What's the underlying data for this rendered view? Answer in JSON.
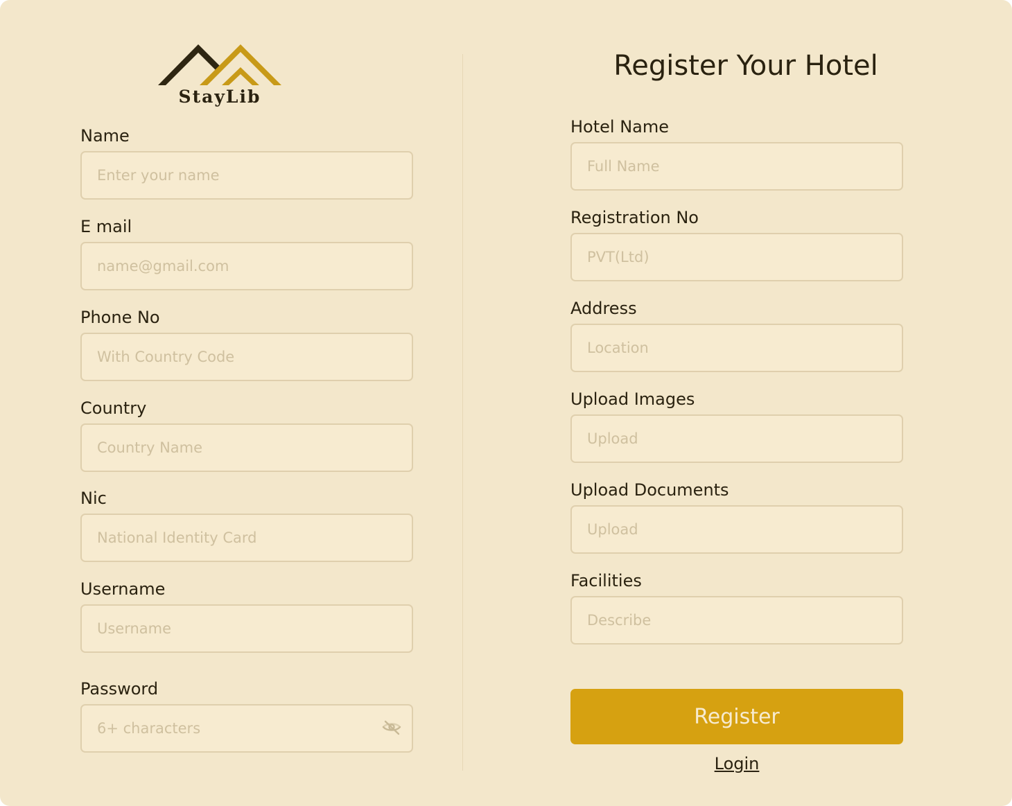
{
  "brand": {
    "name": "StayLib",
    "logo_icon": "mountain-roofs-logo"
  },
  "colors": {
    "background": "#f3e7cb",
    "input_background": "#f7ebd0",
    "input_border": "#dfcfad",
    "accent": "#d6a111",
    "text": "#2a2210",
    "placeholder": "#cfc09f"
  },
  "left_form": {
    "name": {
      "label": "Name",
      "placeholder": "Enter your name"
    },
    "email": {
      "label": "E mail",
      "placeholder": "name@gmail.com"
    },
    "phone": {
      "label": "Phone No",
      "placeholder": "With Country Code"
    },
    "country": {
      "label": "Country",
      "placeholder": "Country Name"
    },
    "nic": {
      "label": "Nic",
      "placeholder": "National Identity Card"
    },
    "username": {
      "label": "Username",
      "placeholder": "Username"
    },
    "password": {
      "label": "Password",
      "placeholder": "6+ characters",
      "toggle_icon": "eye-off-icon"
    }
  },
  "right_form": {
    "title": "Register Your Hotel",
    "hotel_name": {
      "label": "Hotel Name",
      "placeholder": "Full Name"
    },
    "registration_no": {
      "label": "Registration No",
      "placeholder": "PVT(Ltd)"
    },
    "address": {
      "label": "Address",
      "placeholder": "Location"
    },
    "upload_images": {
      "label": "Upload Images",
      "placeholder": "Upload"
    },
    "upload_documents": {
      "label": "Upload Documents",
      "placeholder": "Upload"
    },
    "facilities": {
      "label": "Facilities",
      "placeholder": "Describe"
    },
    "register_label": "Register",
    "login_label": "Login"
  }
}
